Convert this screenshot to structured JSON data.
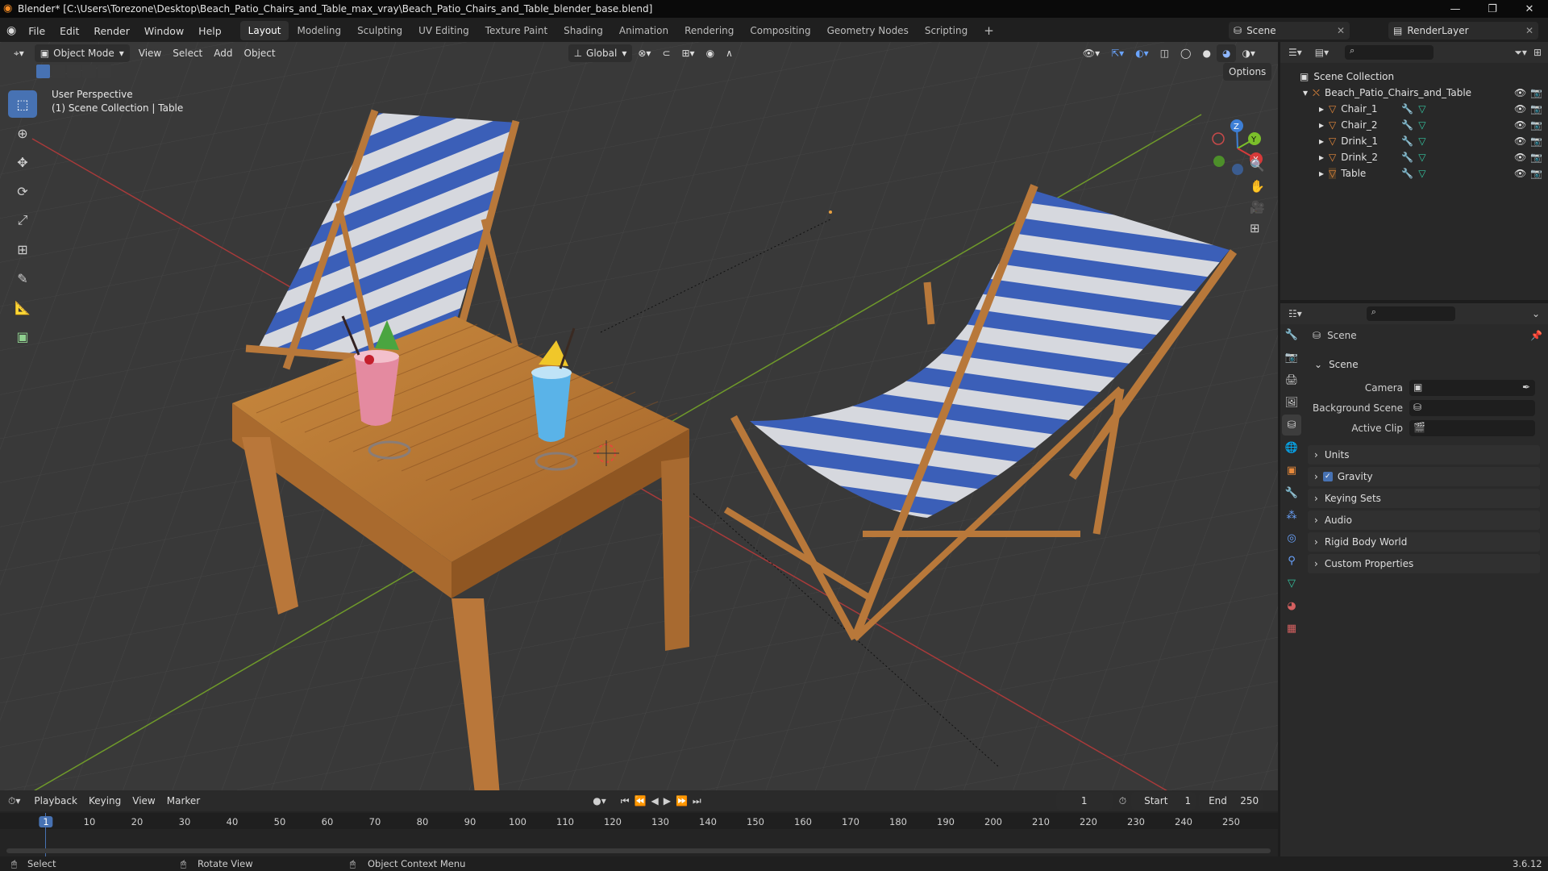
{
  "titlebar": {
    "title": "Blender* [C:\\Users\\Torezone\\Desktop\\Beach_Patio_Chairs_and_Table_max_vray\\Beach_Patio_Chairs_and_Table_blender_base.blend]"
  },
  "menus": [
    "File",
    "Edit",
    "Render",
    "Window",
    "Help"
  ],
  "workspaces": [
    "Layout",
    "Modeling",
    "Sculpting",
    "UV Editing",
    "Texture Paint",
    "Shading",
    "Animation",
    "Rendering",
    "Compositing",
    "Geometry Nodes",
    "Scripting"
  ],
  "active_workspace": "Layout",
  "add_workspace": "+",
  "scene_selector": "Scene",
  "view_layer": "RenderLayer",
  "viewport_header": {
    "mode": "Object Mode",
    "menus": [
      "View",
      "Select",
      "Add",
      "Object"
    ],
    "transform_orientation": "Global",
    "options": "Options"
  },
  "viewport_overlay": {
    "perspective": "User Perspective",
    "collection_info": "(1) Scene Collection | Table"
  },
  "gizmo": {
    "z": "Z",
    "y": "Y",
    "x": "X"
  },
  "outliner": {
    "root": "Scene Collection",
    "collection": "Beach_Patio_Chairs_and_Table",
    "objects": [
      "Chair_1",
      "Chair_2",
      "Drink_1",
      "Drink_2",
      "Table"
    ]
  },
  "properties": {
    "header": "Scene",
    "panel_title": "Scene",
    "fields": [
      {
        "label": "Camera",
        "value": ""
      },
      {
        "label": "Background Scene",
        "value": ""
      },
      {
        "label": "Active Clip",
        "value": ""
      }
    ],
    "panels": [
      "Units",
      "Gravity",
      "Keying Sets",
      "Audio",
      "Rigid Body World",
      "Custom Properties"
    ],
    "gravity_checked": true
  },
  "timeline": {
    "menus": [
      "Playback",
      "Keying",
      "View",
      "Marker"
    ],
    "current_frame": "1",
    "start_label": "Start",
    "start": "1",
    "end_label": "End",
    "end": "250",
    "frame_ticks": [
      "1",
      "10",
      "20",
      "30",
      "40",
      "50",
      "60",
      "70",
      "80",
      "90",
      "100",
      "110",
      "120",
      "130",
      "140",
      "150",
      "160",
      "170",
      "180",
      "190",
      "200",
      "210",
      "220",
      "230",
      "240",
      "250"
    ]
  },
  "statusbar": {
    "select": "Select",
    "rotate": "Rotate View",
    "context": "Object Context Menu",
    "version": "3.6.12"
  },
  "colors": {
    "accent": "#4772b3",
    "x_axis": "#d63a3a",
    "y_axis": "#7bbf2a",
    "z_axis": "#3d7fd6",
    "object_icon": "#e7893b",
    "mesh_icon": "#34c4a0"
  }
}
